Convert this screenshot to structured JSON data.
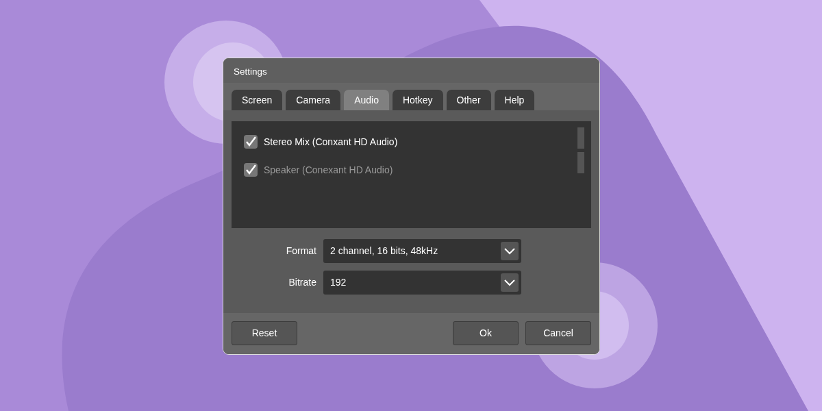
{
  "window": {
    "title": "Settings"
  },
  "tabs": [
    {
      "label": "Screen",
      "selected": false
    },
    {
      "label": "Camera",
      "selected": false
    },
    {
      "label": "Audio",
      "selected": true
    },
    {
      "label": "Hotkey",
      "selected": false
    },
    {
      "label": "Other",
      "selected": false
    },
    {
      "label": "Help",
      "selected": false
    }
  ],
  "devices": [
    {
      "name": "Stereo Mix (Conxant HD Audio)",
      "checked": true,
      "disabled": false
    },
    {
      "name": "Speaker (Conexant HD Audio)",
      "checked": true,
      "disabled": true
    }
  ],
  "fields": [
    {
      "label": "Format",
      "value": "2 channel, 16 bits, 48kHz"
    },
    {
      "label": "Bitrate",
      "value": "192"
    }
  ],
  "buttons": {
    "left": [
      "Reset"
    ],
    "right": [
      "Ok",
      "Cancel"
    ]
  }
}
